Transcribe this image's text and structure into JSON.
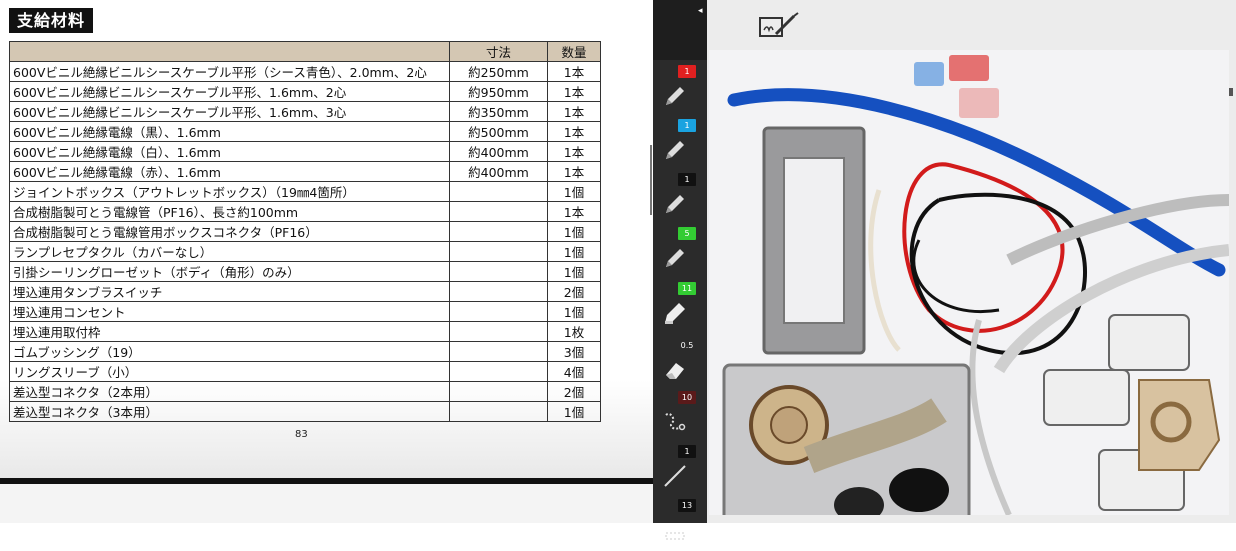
{
  "doc": {
    "title": "支給材料",
    "headers": [
      "",
      "寸法",
      "数量"
    ],
    "rows": [
      [
        "600Vビニル絶縁ビニルシースケーブル平形（シース青色）、2.0mm、2心",
        "約250mm",
        "1本"
      ],
      [
        "600Vビニル絶縁ビニルシースケーブル平形、1.6mm、2心",
        "約950mm",
        "1本"
      ],
      [
        "600Vビニル絶縁ビニルシースケーブル平形、1.6mm、3心",
        "約350mm",
        "1本"
      ],
      [
        "600Vビニル絶縁電線（黒）、1.6mm",
        "約500mm",
        "1本"
      ],
      [
        "600Vビニル絶縁電線（白）、1.6mm",
        "約400mm",
        "1本"
      ],
      [
        "600Vビニル絶縁電線（赤）、1.6mm",
        "約400mm",
        "1本"
      ],
      [
        "ジョイントボックス（アウトレットボックス）（19㎜4箇所）",
        "",
        "1個"
      ],
      [
        "合成樹脂製可とう電線管（PF16）、長さ約100mm",
        "",
        "1本"
      ],
      [
        "合成樹脂製可とう電線管用ボックスコネクタ（PF16）",
        "",
        "1個"
      ],
      [
        "ランプレセプタクル（カバーなし）",
        "",
        "1個"
      ],
      [
        "引掛シーリングローゼット（ボディ（角形）のみ）",
        "",
        "1個"
      ],
      [
        "埋込連用タンブラスイッチ",
        "",
        "2個"
      ],
      [
        "埋込連用コンセント",
        "",
        "1個"
      ],
      [
        "埋込連用取付枠",
        "",
        "1枚"
      ],
      [
        "ゴムブッシング（19）",
        "",
        "3個"
      ],
      [
        "リングスリーブ（小）",
        "",
        "4個"
      ],
      [
        "差込型コネクタ（2本用）",
        "",
        "2個"
      ],
      [
        "差込型コネクタ（3本用）",
        "",
        "1個"
      ]
    ],
    "page_number": "83"
  },
  "toolbar": {
    "collapse_glyph": "◂",
    "tools": [
      {
        "name": "pen-red",
        "badge": "1",
        "badge_color": "#e02020",
        "icon": "pen-icon"
      },
      {
        "name": "pen-blue",
        "badge": "1",
        "badge_color": "#1aa3e0",
        "icon": "pen-icon"
      },
      {
        "name": "pen-black",
        "badge": "1",
        "badge_color": "#111111",
        "icon": "pen-icon"
      },
      {
        "name": "highlighter-green",
        "badge": "5",
        "badge_color": "#33cc33",
        "icon": "pen-icon"
      },
      {
        "name": "highlighter-green-wide",
        "badge": "11",
        "badge_color": "#33cc33",
        "icon": "marker-icon"
      },
      {
        "name": "eraser",
        "badge": "0.5",
        "badge_color": "transparent",
        "icon": "eraser-icon"
      },
      {
        "name": "lasso",
        "badge": "10",
        "badge_color": "#5a1a1a",
        "icon": "lasso-icon"
      },
      {
        "name": "line",
        "badge": "1",
        "badge_color": "#111111",
        "icon": "line-icon"
      },
      {
        "name": "shape",
        "badge": "13",
        "badge_color": "#111111",
        "icon": "shape-icon"
      }
    ]
  },
  "canvas": {
    "note_icon": "signature-edit-icon"
  }
}
